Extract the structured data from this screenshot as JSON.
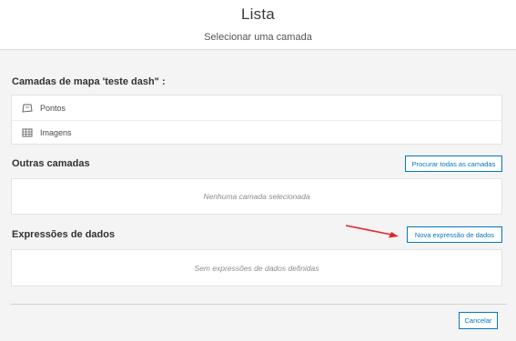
{
  "header": {
    "title": "Lista",
    "subtitle": "Selecionar uma camada"
  },
  "map_layers": {
    "title": "Camadas de mapa 'teste dash\" :",
    "items": [
      {
        "label": "Pontos",
        "icon": "polygon-layer-icon"
      },
      {
        "label": "Imagens",
        "icon": "table-layer-icon"
      }
    ]
  },
  "other_layers": {
    "title": "Outras camadas",
    "browse_button": "Procurar todas as camadas",
    "empty_text": "Nenhuma camada selecionada"
  },
  "data_expressions": {
    "title": "Expressões de dados",
    "new_button": "Nova expressão de dados",
    "empty_text": "Sem expressões de dados definidas"
  },
  "footer": {
    "cancel_button": "Cancelar"
  },
  "colors": {
    "accent": "#0079c1",
    "annotation_arrow": "#e3262b"
  }
}
